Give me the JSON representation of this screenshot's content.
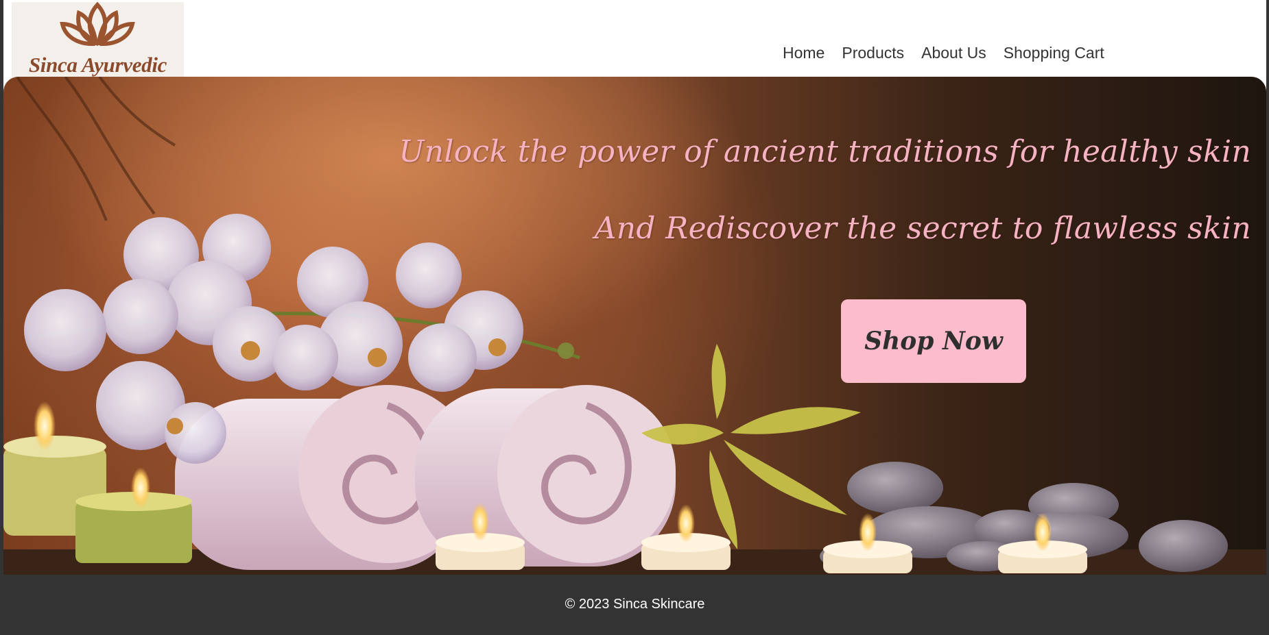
{
  "logo": {
    "icon": "lotus-icon",
    "text": "Sinca Ayurvedic"
  },
  "nav": {
    "items": [
      {
        "label": "Home"
      },
      {
        "label": "Products"
      },
      {
        "label": "About Us"
      },
      {
        "label": "Shopping Cart"
      }
    ]
  },
  "hero": {
    "tagline_1": "Unlock the power of ancient traditions for healthy skin",
    "tagline_2": "And Rediscover the secret to flawless skin",
    "cta_label": "Shop Now",
    "image": "spa-orchids-towels-candles-stones"
  },
  "footer": {
    "copyright": "© 2023 Sinca Skincare"
  },
  "colors": {
    "accent_pink": "#fdbccb",
    "tagline_pink": "#f6b3c3",
    "logo_brown": "#8b4a2b",
    "footer_bg": "#333333"
  }
}
